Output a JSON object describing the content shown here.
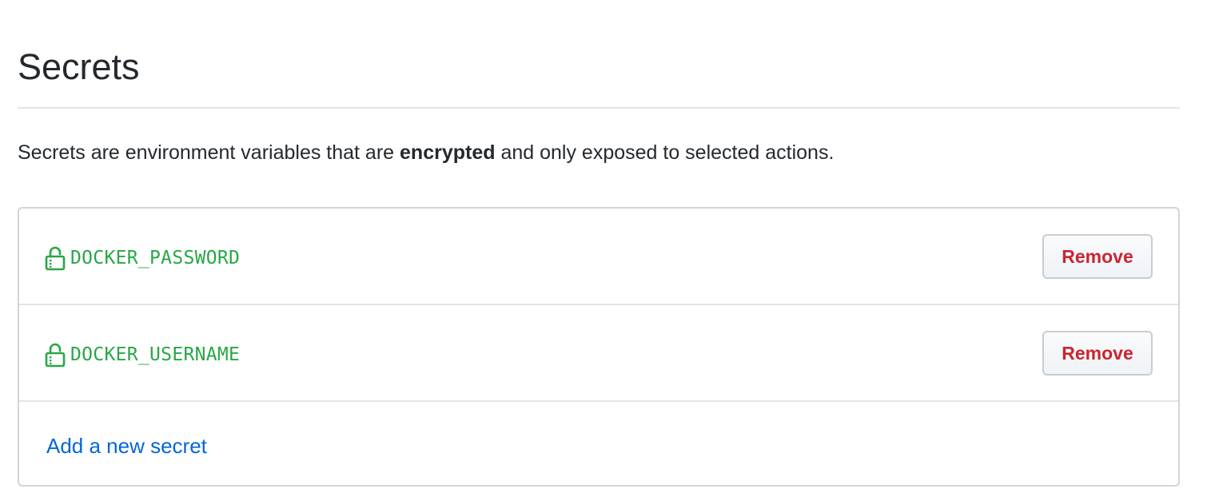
{
  "page": {
    "title": "Secrets",
    "description_before": "Secrets are environment variables that are ",
    "description_bold": "encrypted",
    "description_after": " and only exposed to selected actions."
  },
  "secrets": [
    {
      "name": "DOCKER_PASSWORD",
      "remove_label": "Remove",
      "icon": "lock-icon"
    },
    {
      "name": "DOCKER_USERNAME",
      "remove_label": "Remove",
      "icon": "lock-icon"
    }
  ],
  "add_link_label": "Add a new secret",
  "colors": {
    "secret_name": "#28a745",
    "remove_text": "#cb2431",
    "link": "#0366d6",
    "border": "#d1d5da"
  }
}
